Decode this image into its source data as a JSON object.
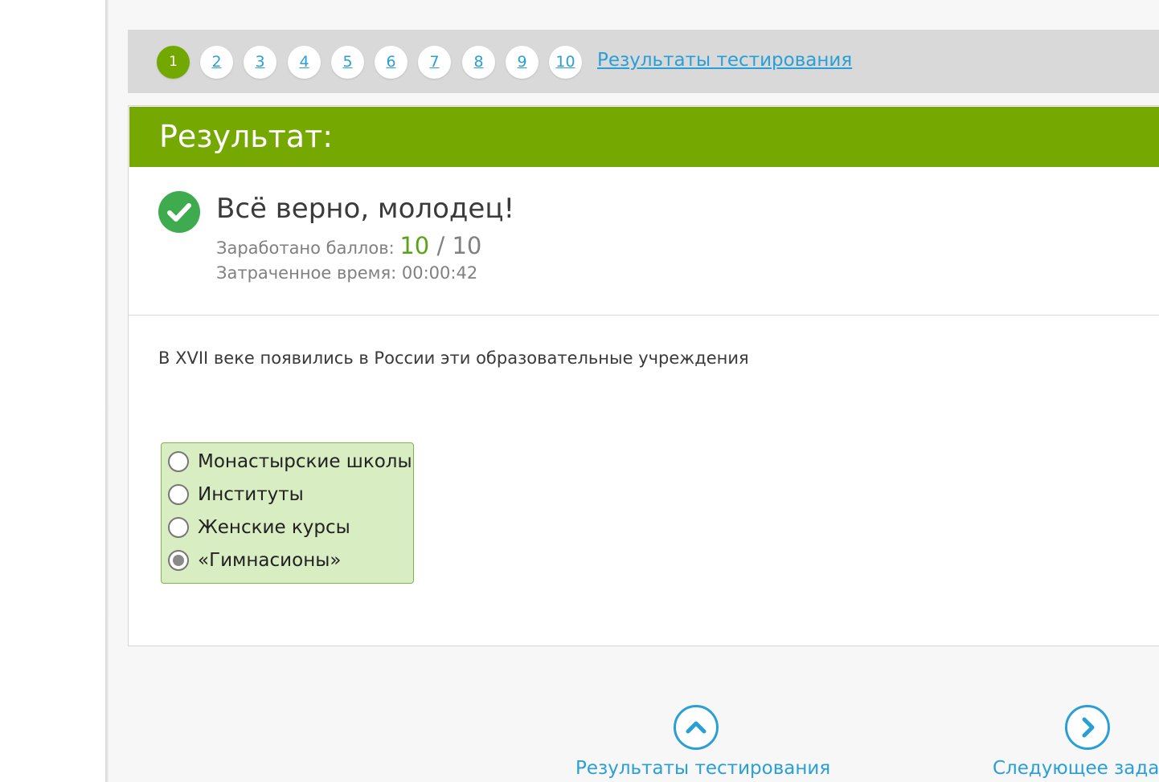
{
  "pager": {
    "items": [
      "1",
      "2",
      "3",
      "4",
      "5",
      "6",
      "7",
      "8",
      "9",
      "10"
    ],
    "active_index": 0,
    "results_link": "Результаты тестирования"
  },
  "result": {
    "title": "Результат:",
    "status_icon": "check-icon",
    "verdict": "Всё верно, молодец!",
    "score_label": "Заработано баллов:",
    "score_value": "10",
    "score_max": " / 10",
    "time_label": "Затраченное время:",
    "time_value": "00:00:42"
  },
  "question": {
    "text": "В XVII веке появились в России эти образовательные учреждения",
    "answers": [
      {
        "label": "Монастырские школы",
        "selected": false
      },
      {
        "label": "Институты",
        "selected": false
      },
      {
        "label": "Женские курсы",
        "selected": false
      },
      {
        "label": "«Гимнасионы»",
        "selected": true
      }
    ]
  },
  "navigation": {
    "results_label": "Результаты тестирования",
    "results_icon": "chevron-up-icon",
    "next_label": "Следующее задание",
    "next_icon": "chevron-right-icon"
  },
  "colors": {
    "accent_green": "#75a902",
    "link_blue": "#2a9fd6",
    "correct_green": "#3eab4f",
    "answer_bg": "#d9edc3"
  }
}
